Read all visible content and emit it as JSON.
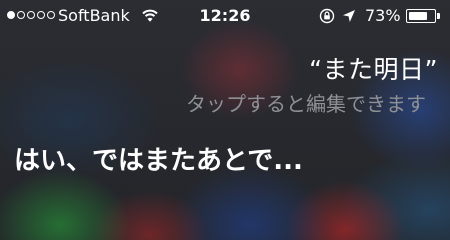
{
  "status_bar": {
    "signal_strength": 1,
    "signal_total": 5,
    "carrier": "SoftBank",
    "time": "12:26",
    "battery_percent_text": "73%",
    "battery_level": 0.73,
    "icons": [
      "wifi-icon",
      "rotation-lock-icon",
      "location-arrow-icon",
      "battery-icon"
    ]
  },
  "siri": {
    "user_query": "“また明日”",
    "tap_to_edit_hint": "タップすると編集できます",
    "response": "はい、ではまたあとで..."
  },
  "colors": {
    "text_primary": "#ffffff",
    "text_hint": "#8f9095",
    "background": "#2a2c30"
  }
}
